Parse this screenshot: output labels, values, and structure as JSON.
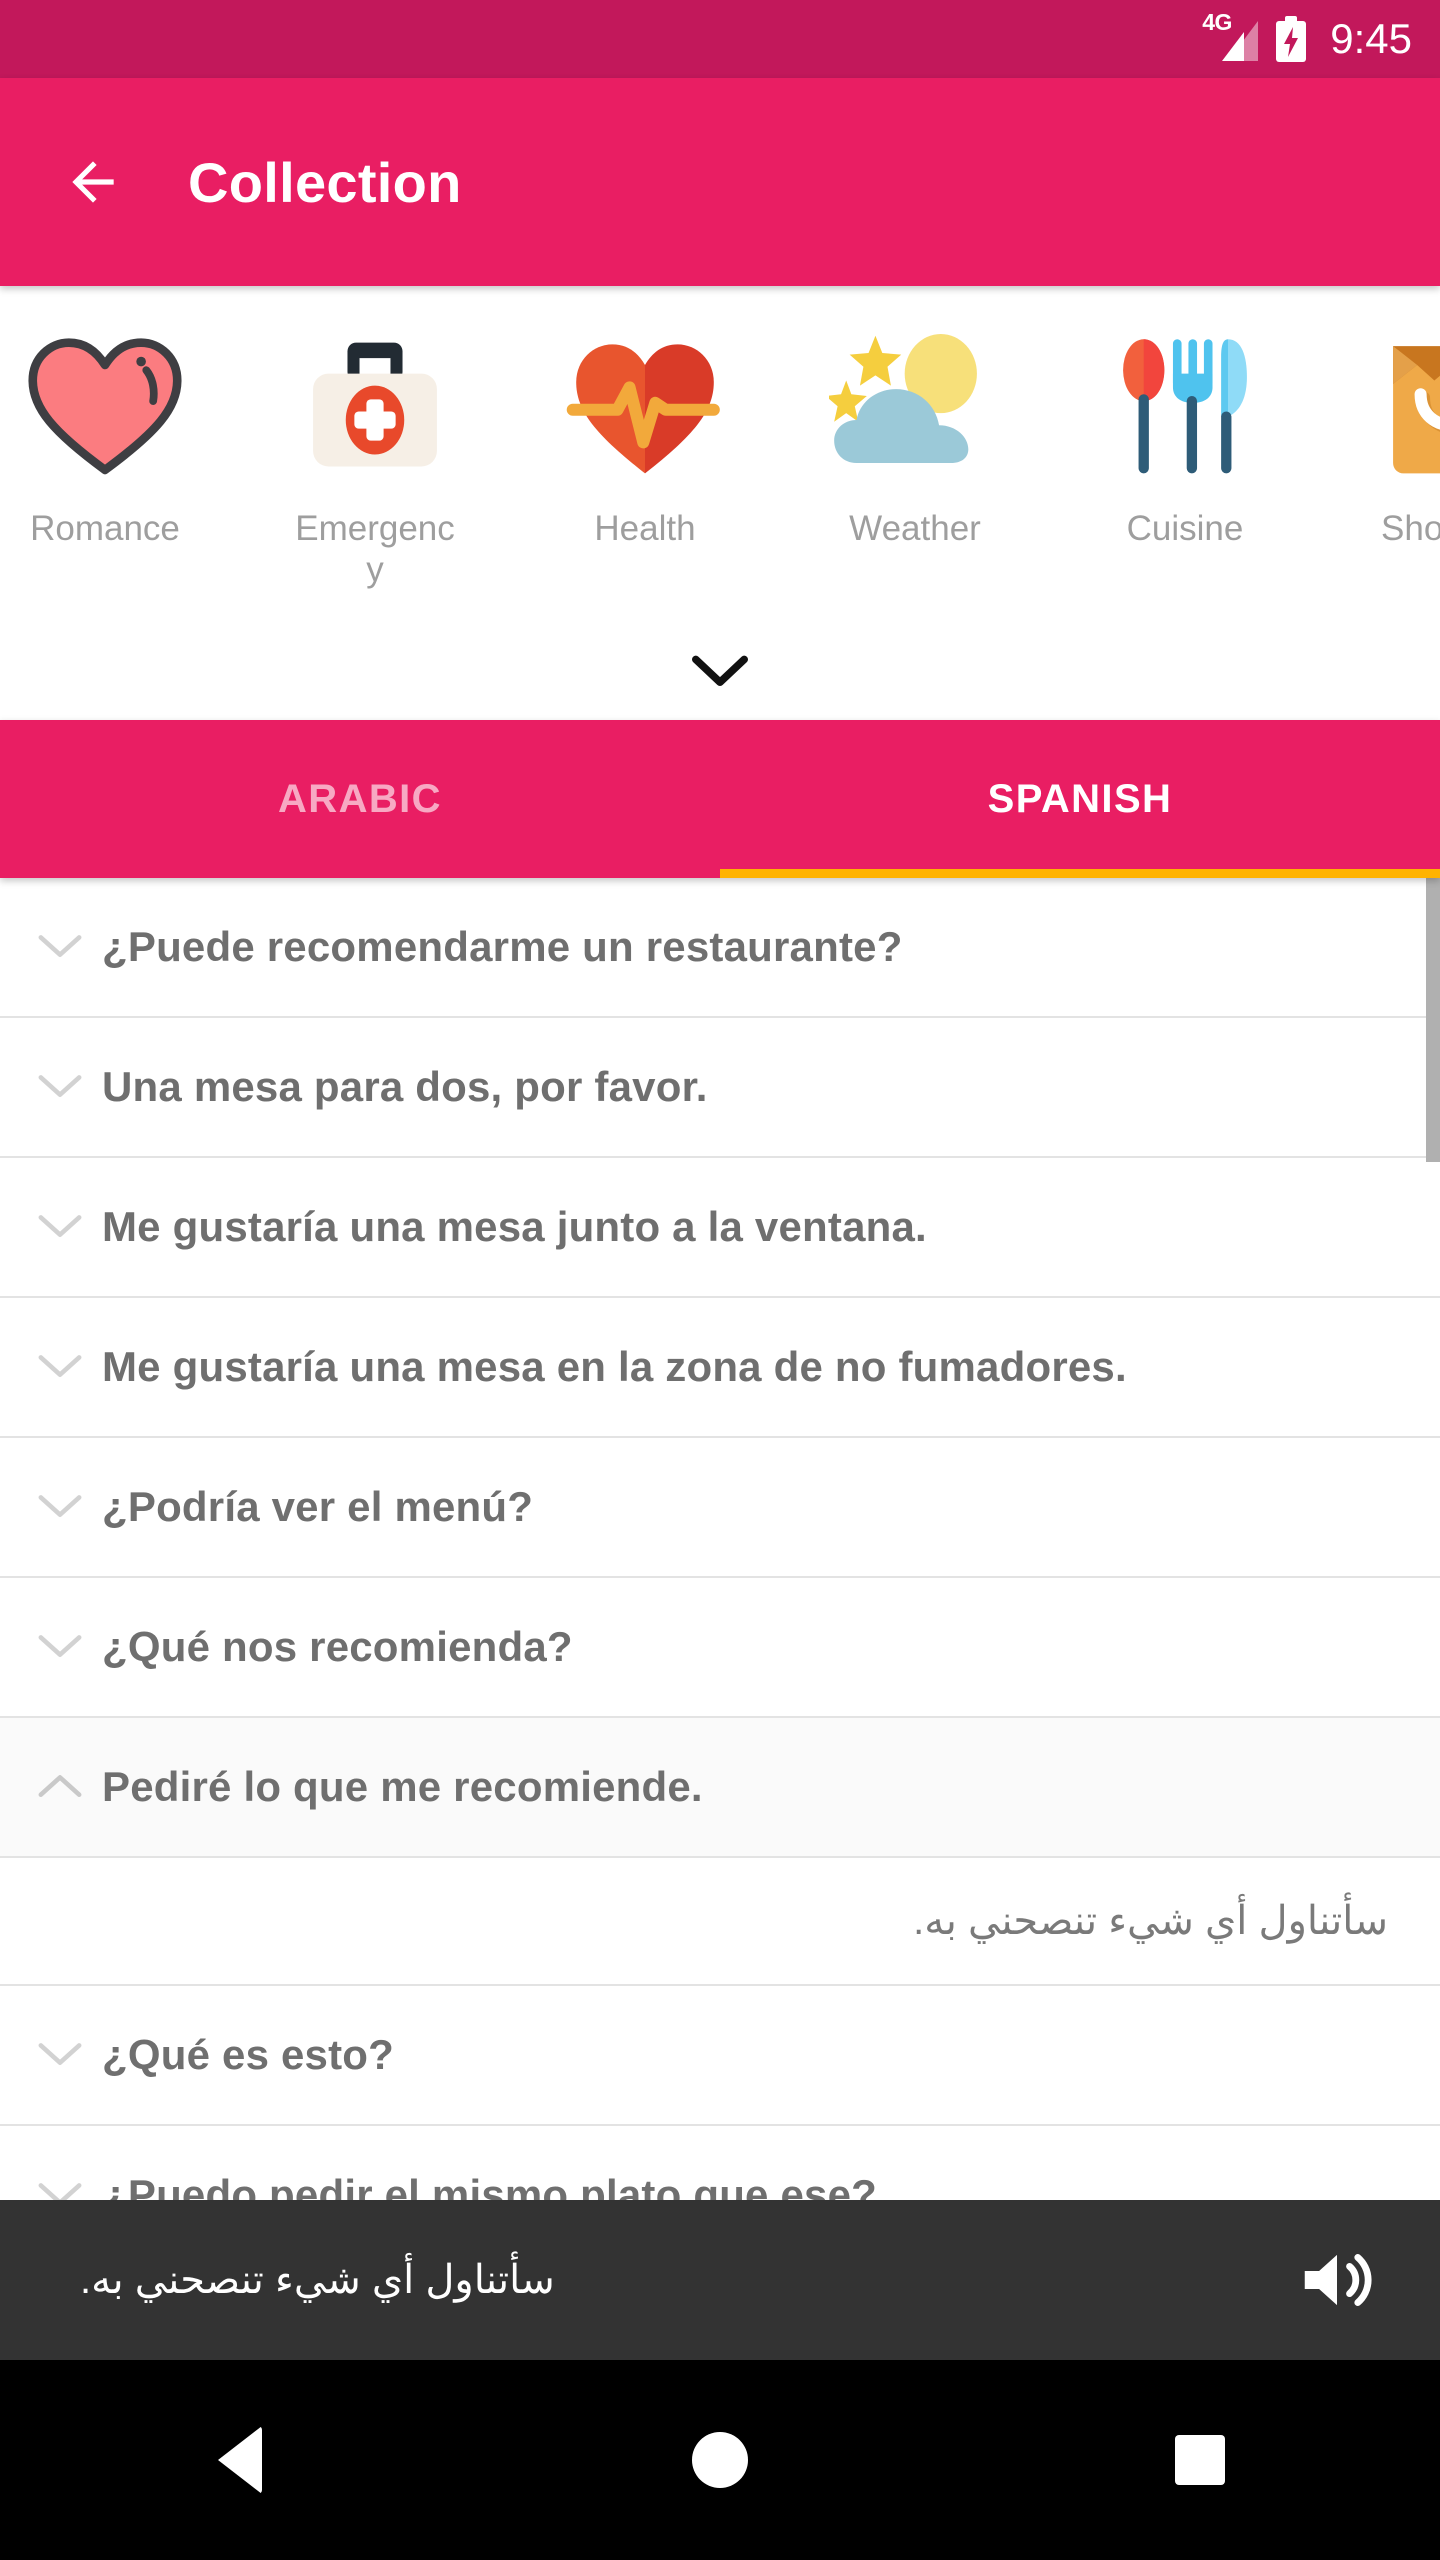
{
  "statusbar": {
    "network_label": "4G",
    "time": "9:45",
    "battery_icon": "battery-charging-icon",
    "signal_icon": "signal-4g-icon"
  },
  "appbar": {
    "back_icon": "back-arrow-icon",
    "title": "Collection",
    "background": "#E91E63"
  },
  "categories": {
    "expand_icon": "chevron-down-icon",
    "items": [
      {
        "label": "Romance",
        "icon": "heart-pink-icon"
      },
      {
        "label": "Emergency",
        "icon": "first-aid-kit-icon"
      },
      {
        "label": "Health",
        "icon": "heart-pulse-icon"
      },
      {
        "label": "Weather",
        "icon": "sun-cloud-icon"
      },
      {
        "label": "Cuisine",
        "icon": "cutlery-icon"
      },
      {
        "label": "Shopping",
        "icon": "shopping-bag-icon"
      }
    ]
  },
  "tabs": {
    "items": [
      {
        "label": "ARABIC",
        "active": false
      },
      {
        "label": "SPANISH",
        "active": true
      }
    ],
    "indicator_color": "#FFB300"
  },
  "phrases": {
    "collapse_icon": "chevron-up-icon",
    "expand_icon": "chevron-down-icon",
    "rows": [
      {
        "text": "¿Puede recomendarme un restaurante?",
        "expanded": false
      },
      {
        "text": "Una mesa para dos, por favor.",
        "expanded": false
      },
      {
        "text": "Me gustaría una mesa junto a la ventana.",
        "expanded": false
      },
      {
        "text": "Me gustaría una mesa en la zona de no fumadores.",
        "expanded": false
      },
      {
        "text": "¿Podría ver el menú?",
        "expanded": false
      },
      {
        "text": "¿Qué nos recomienda?",
        "expanded": false
      },
      {
        "text": "Pediré lo que me recomiende.",
        "expanded": true,
        "translation": "سأتناول أي شيء تنصحني به."
      },
      {
        "text": "¿Qué es esto?",
        "expanded": false
      },
      {
        "text": "¿Puedo pedir el mismo plato que ese?",
        "expanded": false
      }
    ]
  },
  "playbar": {
    "text": "سأتناول أي شيء تنصحني به.",
    "speaker_icon": "speaker-volume-icon",
    "background": "#333333"
  },
  "navbar": {
    "back_icon": "nav-back-triangle-icon",
    "home_icon": "nav-home-circle-icon",
    "recents_icon": "nav-recents-square-icon"
  }
}
